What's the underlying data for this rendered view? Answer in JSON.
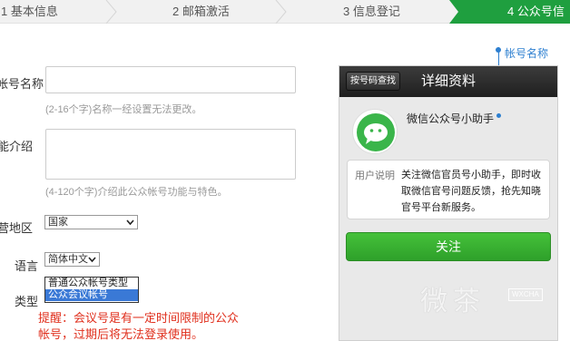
{
  "steps": [
    {
      "label": "1 基本信息"
    },
    {
      "label": "2 邮箱激活"
    },
    {
      "label": "3 信息登记"
    },
    {
      "label": "4 公众号信息"
    }
  ],
  "colors": {
    "active_step": "#1f9f3f",
    "link_blue": "#2d7fd0",
    "warning": "#e0301e",
    "follow": "#3bb230"
  },
  "form": {
    "account_name": {
      "label": "帐号名称",
      "value": "",
      "hint": "(2-16个字)名称一经设置无法更改。"
    },
    "function_intro": {
      "label": "功能介绍",
      "value": "",
      "hint": "(4-120个字)介绍此公众帐号功能与特色。"
    },
    "operating_region": {
      "label": "运营地区",
      "selected": "国家"
    },
    "language": {
      "label": "语言",
      "selected": "简体中文"
    },
    "type": {
      "label": "类型",
      "options": [
        "普通公众帐号类型",
        "公众会议帐号"
      ],
      "selected_index": 1
    },
    "warning": "提醒：会议号是有一定时间限制的公众帐号，过期后将无法登录使用。"
  },
  "annotation": {
    "label": "帐号名称"
  },
  "preview": {
    "back_button": "按号码查找",
    "title": "详细资料",
    "account_name": "微信公众号小助手",
    "avatar_icon": "wechat-logo-icon",
    "description_label": "用户说明",
    "description": "关注微信官员号小助手，即时收取微信官号问题反馈，抢先知晓官号平台新服务。",
    "follow_button": "关注"
  },
  "watermark": {
    "text": "微茶",
    "badge": "WXCHA"
  }
}
